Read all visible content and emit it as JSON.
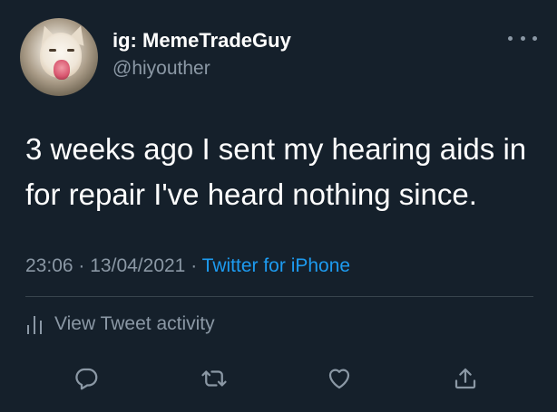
{
  "user": {
    "display_name": "ig: MemeTradeGuy",
    "handle": "@hiyouther",
    "avatar_icon": "cat-avatar"
  },
  "tweet": {
    "text": "3 weeks ago I sent my hearing aids in for repair I've heard nothing since.",
    "time": "23:06",
    "separator_1": "·",
    "date": "13/04/2021",
    "separator_2": "·",
    "source": "Twitter for iPhone"
  },
  "activity": {
    "label": "View Tweet activity",
    "icon": "bar-chart-icon"
  },
  "actions": [
    {
      "name": "reply",
      "icon": "reply-icon"
    },
    {
      "name": "retweet",
      "icon": "retweet-icon"
    },
    {
      "name": "like",
      "icon": "heart-icon"
    },
    {
      "name": "share",
      "icon": "share-icon"
    }
  ],
  "colors": {
    "background": "#15202b",
    "text": "#ffffff",
    "secondary_text": "#8b98a5",
    "link": "#1d9bf0",
    "divider": "#38444d"
  }
}
